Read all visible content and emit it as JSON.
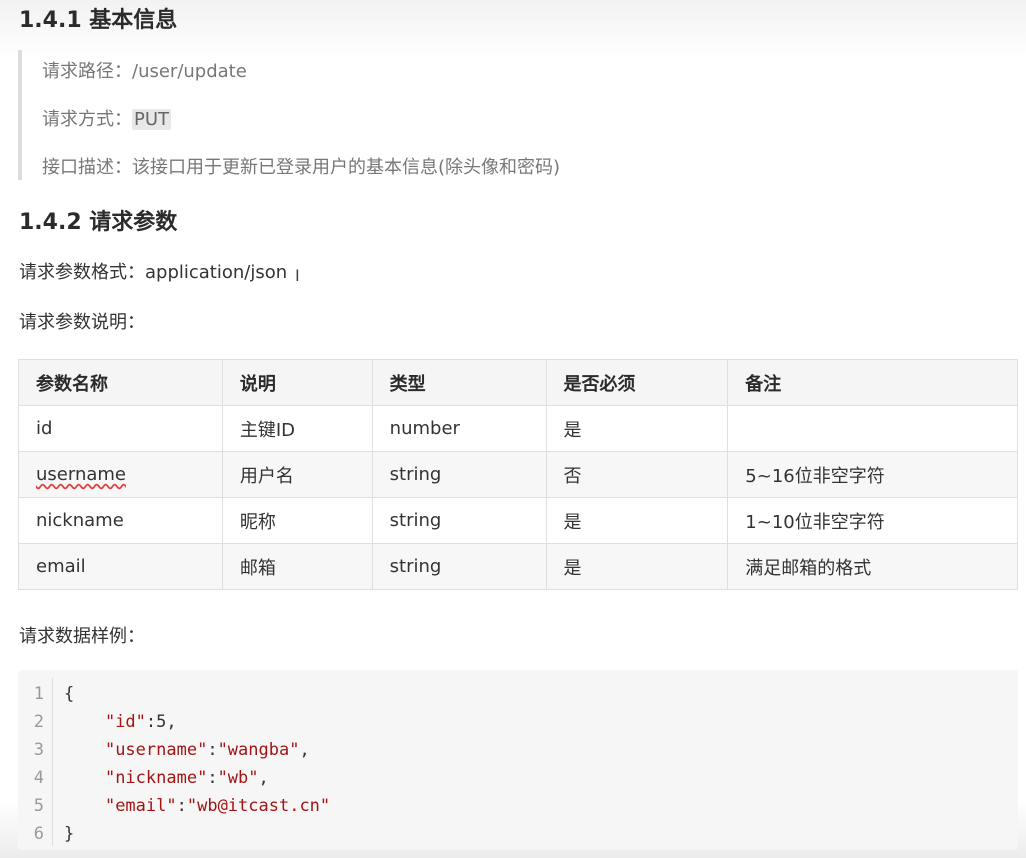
{
  "section_basic": {
    "heading": "1.4.1 基本信息",
    "path_label": "请求路径：",
    "path_value": "/user/update",
    "method_label": "请求方式：",
    "method_value": "PUT",
    "desc_label": "接口描述：",
    "desc_value": "该接口用于更新已登录用户的基本信息(除头像和密码)"
  },
  "section_params": {
    "heading": "1.4.2 请求参数",
    "format_text": "请求参数格式：application/json",
    "desc_text": "请求参数说明：",
    "table": {
      "headers": [
        "参数名称",
        "说明",
        "类型",
        "是否必须",
        "备注"
      ],
      "rows": [
        [
          "id",
          "主键ID",
          "number",
          "是",
          ""
        ],
        [
          "username",
          "用户名",
          "string",
          "否",
          "5~16位非空字符"
        ],
        [
          "nickname",
          "昵称",
          "string",
          "是",
          "1~10位非空字符"
        ],
        [
          "email",
          "邮箱",
          "string",
          "是",
          "满足邮箱的格式"
        ]
      ]
    },
    "sample_text": "请求数据样例：",
    "code": {
      "line_numbers": [
        "1",
        "2",
        "3",
        "4",
        "5",
        "6"
      ],
      "lines": [
        {
          "pre": "{",
          "key": "",
          "mid": "",
          "val": "",
          "post": ""
        },
        {
          "pre": "    ",
          "key": "\"id\"",
          "mid": ":",
          "val": "5",
          "post": ","
        },
        {
          "pre": "    ",
          "key": "\"username\"",
          "mid": ":",
          "val": "\"wangba\"",
          "post": ","
        },
        {
          "pre": "    ",
          "key": "\"nickname\"",
          "mid": ":",
          "val": "\"wb\"",
          "post": ","
        },
        {
          "pre": "    ",
          "key": "\"email\"",
          "mid": ":",
          "val": "\"wb@itcast.cn\"",
          "post": ""
        },
        {
          "pre": "}",
          "key": "",
          "mid": "",
          "val": "",
          "post": ""
        }
      ]
    }
  }
}
